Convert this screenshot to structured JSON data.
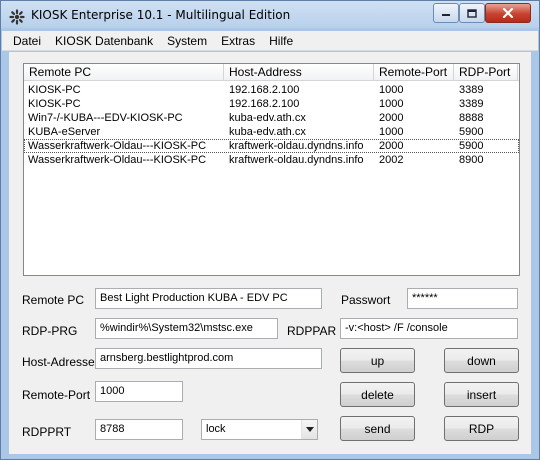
{
  "window": {
    "title": "KIOSK Enterprise 10.1 - Multilingual Edition",
    "app_icon": "kiosk-app-icon",
    "caption_buttons": {
      "minimize": "minimize-icon",
      "maximize": "maximize-icon",
      "close": "close-icon"
    }
  },
  "menu": {
    "items": [
      "Datei",
      "KIOSK Datenbank",
      "System",
      "Extras",
      "Hilfe"
    ]
  },
  "list": {
    "columns": [
      "Remote PC",
      "Host-Address",
      "Remote-Port",
      "RDP-Port"
    ],
    "rows": [
      [
        "KIOSK-PC",
        "192.168.2.100",
        "1000",
        "3389"
      ],
      [
        "KIOSK-PC",
        "192.168.2.100",
        "1000",
        "3389"
      ],
      [
        "Win7-/-KUBA---EDV-KIOSK-PC",
        "kuba-edv.ath.cx",
        "2000",
        "8888"
      ],
      [
        "KUBA-eServer",
        "kuba-edv.ath.cx",
        "1000",
        "5900"
      ],
      [
        "Wasserkraftwerk-Oldau---KIOSK-PC",
        "kraftwerk-oldau.dyndns.info",
        "2000",
        "5900"
      ],
      [
        "Wasserkraftwerk-Oldau---KIOSK-PC",
        "kraftwerk-oldau.dyndns.info",
        "2002",
        "8900"
      ]
    ]
  },
  "form": {
    "remote_pc_label": "Remote PC",
    "remote_pc_value": "Best Light Production KUBA - EDV PC",
    "password_label": "Passwort",
    "password_value": "******",
    "rdp_prg_label": "RDP-PRG",
    "rdp_prg_value": "%windir%\\System32\\mstsc.exe",
    "rdppar_label": "RDPPAR",
    "rdppar_value": "-v:<host> /F /console",
    "host_label": "Host-Adresse",
    "host_value": "arnsberg.bestlightprod.com",
    "remote_port_label": "Remote-Port",
    "remote_port_value": "1000",
    "rdpprt_label": "RDPPRT",
    "rdpprt_value": "8788",
    "mode_value": "lock"
  },
  "buttons": {
    "up": "up",
    "down": "down",
    "delete": "delete",
    "insert": "insert",
    "send": "send",
    "rdp": "RDP"
  }
}
